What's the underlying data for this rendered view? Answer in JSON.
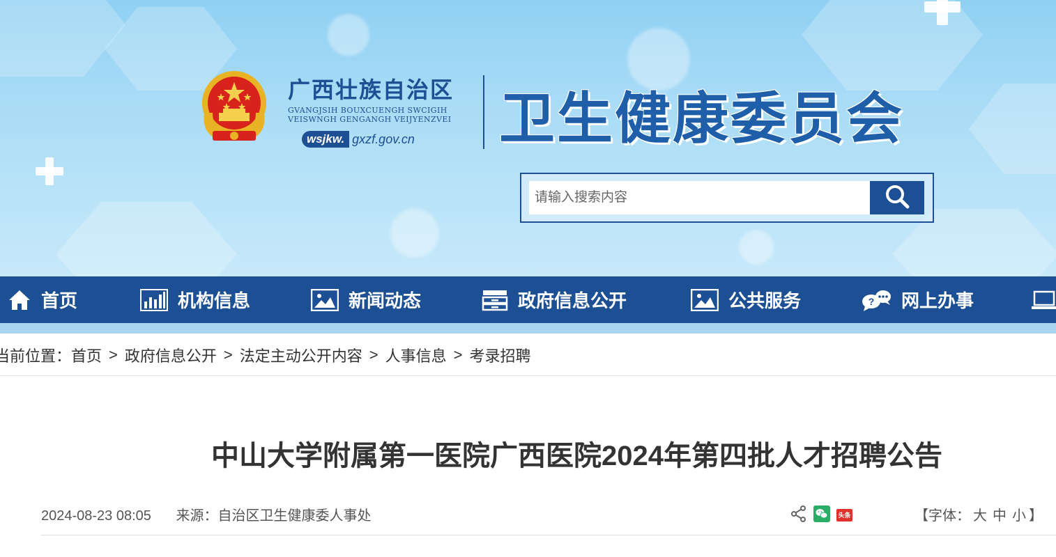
{
  "header": {
    "region_name": "广西壮族自治区",
    "region_zhuang_line1": "GVANGJSIH BOUXCUENGH SWCIGIH",
    "region_zhuang_line2": "VEISWNGH GENGANGH VEIJYENZVEI",
    "url_prefix": "wsjkw.",
    "url_domain": "gxzf.gov.cn",
    "commission_name": "卫生健康委员会",
    "emblem_icon": "national-emblem-icon"
  },
  "search": {
    "placeholder": "请输入搜索内容",
    "button_icon": "search-icon"
  },
  "nav": {
    "items": [
      {
        "label": "首页",
        "icon": "home-icon"
      },
      {
        "label": "机构信息",
        "icon": "bar-chart-icon"
      },
      {
        "label": "新闻动态",
        "icon": "picture-icon"
      },
      {
        "label": "政府信息公开",
        "icon": "archive-icon"
      },
      {
        "label": "公共服务",
        "icon": "picture-icon"
      },
      {
        "label": "网上办事",
        "icon": "chat-icon"
      },
      {
        "label": "",
        "icon": "laptop-icon"
      }
    ]
  },
  "breadcrumb": {
    "prefix": "当前位置：",
    "items": [
      "首页",
      "政府信息公开",
      "法定主动公开内容",
      "人事信息",
      "考录招聘"
    ],
    "separator": ">"
  },
  "article": {
    "title": "中山大学附属第一医院广西医院2024年第四批人才招聘公告",
    "datetime": "2024-08-23 08:05",
    "source": "来源：自治区卫生健康委人事处"
  },
  "share": {
    "icons": [
      "share-icon",
      "wechat-icon",
      "toutiao-icon"
    ],
    "toutiao_text": "头条"
  },
  "font_size": {
    "open": "【字体：",
    "large": "大",
    "medium": "中",
    "small": "小",
    "close": "】"
  },
  "colors": {
    "brand_blue": "#1c4f93",
    "nav_strip": "#a9d4ef",
    "wechat_green": "#2aae67",
    "toutiao_red": "#e2312c"
  }
}
